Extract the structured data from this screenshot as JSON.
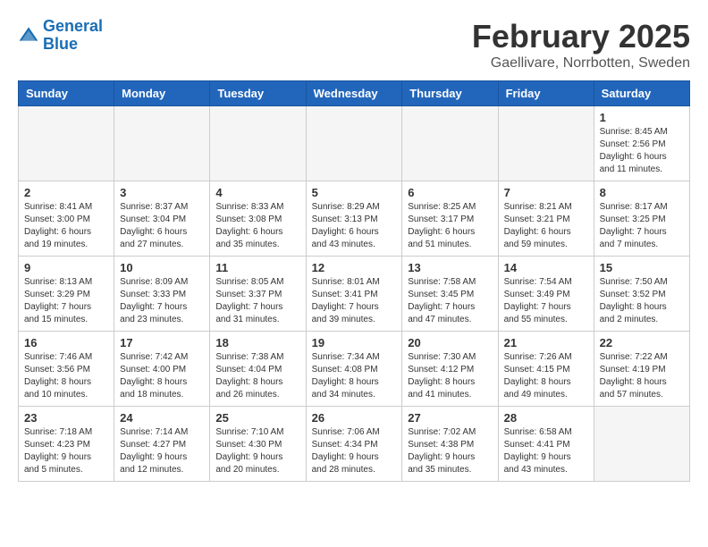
{
  "header": {
    "logo_line1": "General",
    "logo_line2": "Blue",
    "title": "February 2025",
    "subtitle": "Gaellivare, Norrbotten, Sweden"
  },
  "weekdays": [
    "Sunday",
    "Monday",
    "Tuesday",
    "Wednesday",
    "Thursday",
    "Friday",
    "Saturday"
  ],
  "weeks": [
    [
      {
        "day": "",
        "info": ""
      },
      {
        "day": "",
        "info": ""
      },
      {
        "day": "",
        "info": ""
      },
      {
        "day": "",
        "info": ""
      },
      {
        "day": "",
        "info": ""
      },
      {
        "day": "",
        "info": ""
      },
      {
        "day": "1",
        "info": "Sunrise: 8:45 AM\nSunset: 2:56 PM\nDaylight: 6 hours\nand 11 minutes."
      }
    ],
    [
      {
        "day": "2",
        "info": "Sunrise: 8:41 AM\nSunset: 3:00 PM\nDaylight: 6 hours\nand 19 minutes."
      },
      {
        "day": "3",
        "info": "Sunrise: 8:37 AM\nSunset: 3:04 PM\nDaylight: 6 hours\nand 27 minutes."
      },
      {
        "day": "4",
        "info": "Sunrise: 8:33 AM\nSunset: 3:08 PM\nDaylight: 6 hours\nand 35 minutes."
      },
      {
        "day": "5",
        "info": "Sunrise: 8:29 AM\nSunset: 3:13 PM\nDaylight: 6 hours\nand 43 minutes."
      },
      {
        "day": "6",
        "info": "Sunrise: 8:25 AM\nSunset: 3:17 PM\nDaylight: 6 hours\nand 51 minutes."
      },
      {
        "day": "7",
        "info": "Sunrise: 8:21 AM\nSunset: 3:21 PM\nDaylight: 6 hours\nand 59 minutes."
      },
      {
        "day": "8",
        "info": "Sunrise: 8:17 AM\nSunset: 3:25 PM\nDaylight: 7 hours\nand 7 minutes."
      }
    ],
    [
      {
        "day": "9",
        "info": "Sunrise: 8:13 AM\nSunset: 3:29 PM\nDaylight: 7 hours\nand 15 minutes."
      },
      {
        "day": "10",
        "info": "Sunrise: 8:09 AM\nSunset: 3:33 PM\nDaylight: 7 hours\nand 23 minutes."
      },
      {
        "day": "11",
        "info": "Sunrise: 8:05 AM\nSunset: 3:37 PM\nDaylight: 7 hours\nand 31 minutes."
      },
      {
        "day": "12",
        "info": "Sunrise: 8:01 AM\nSunset: 3:41 PM\nDaylight: 7 hours\nand 39 minutes."
      },
      {
        "day": "13",
        "info": "Sunrise: 7:58 AM\nSunset: 3:45 PM\nDaylight: 7 hours\nand 47 minutes."
      },
      {
        "day": "14",
        "info": "Sunrise: 7:54 AM\nSunset: 3:49 PM\nDaylight: 7 hours\nand 55 minutes."
      },
      {
        "day": "15",
        "info": "Sunrise: 7:50 AM\nSunset: 3:52 PM\nDaylight: 8 hours\nand 2 minutes."
      }
    ],
    [
      {
        "day": "16",
        "info": "Sunrise: 7:46 AM\nSunset: 3:56 PM\nDaylight: 8 hours\nand 10 minutes."
      },
      {
        "day": "17",
        "info": "Sunrise: 7:42 AM\nSunset: 4:00 PM\nDaylight: 8 hours\nand 18 minutes."
      },
      {
        "day": "18",
        "info": "Sunrise: 7:38 AM\nSunset: 4:04 PM\nDaylight: 8 hours\nand 26 minutes."
      },
      {
        "day": "19",
        "info": "Sunrise: 7:34 AM\nSunset: 4:08 PM\nDaylight: 8 hours\nand 34 minutes."
      },
      {
        "day": "20",
        "info": "Sunrise: 7:30 AM\nSunset: 4:12 PM\nDaylight: 8 hours\nand 41 minutes."
      },
      {
        "day": "21",
        "info": "Sunrise: 7:26 AM\nSunset: 4:15 PM\nDaylight: 8 hours\nand 49 minutes."
      },
      {
        "day": "22",
        "info": "Sunrise: 7:22 AM\nSunset: 4:19 PM\nDaylight: 8 hours\nand 57 minutes."
      }
    ],
    [
      {
        "day": "23",
        "info": "Sunrise: 7:18 AM\nSunset: 4:23 PM\nDaylight: 9 hours\nand 5 minutes."
      },
      {
        "day": "24",
        "info": "Sunrise: 7:14 AM\nSunset: 4:27 PM\nDaylight: 9 hours\nand 12 minutes."
      },
      {
        "day": "25",
        "info": "Sunrise: 7:10 AM\nSunset: 4:30 PM\nDaylight: 9 hours\nand 20 minutes."
      },
      {
        "day": "26",
        "info": "Sunrise: 7:06 AM\nSunset: 4:34 PM\nDaylight: 9 hours\nand 28 minutes."
      },
      {
        "day": "27",
        "info": "Sunrise: 7:02 AM\nSunset: 4:38 PM\nDaylight: 9 hours\nand 35 minutes."
      },
      {
        "day": "28",
        "info": "Sunrise: 6:58 AM\nSunset: 4:41 PM\nDaylight: 9 hours\nand 43 minutes."
      },
      {
        "day": "",
        "info": ""
      }
    ]
  ]
}
